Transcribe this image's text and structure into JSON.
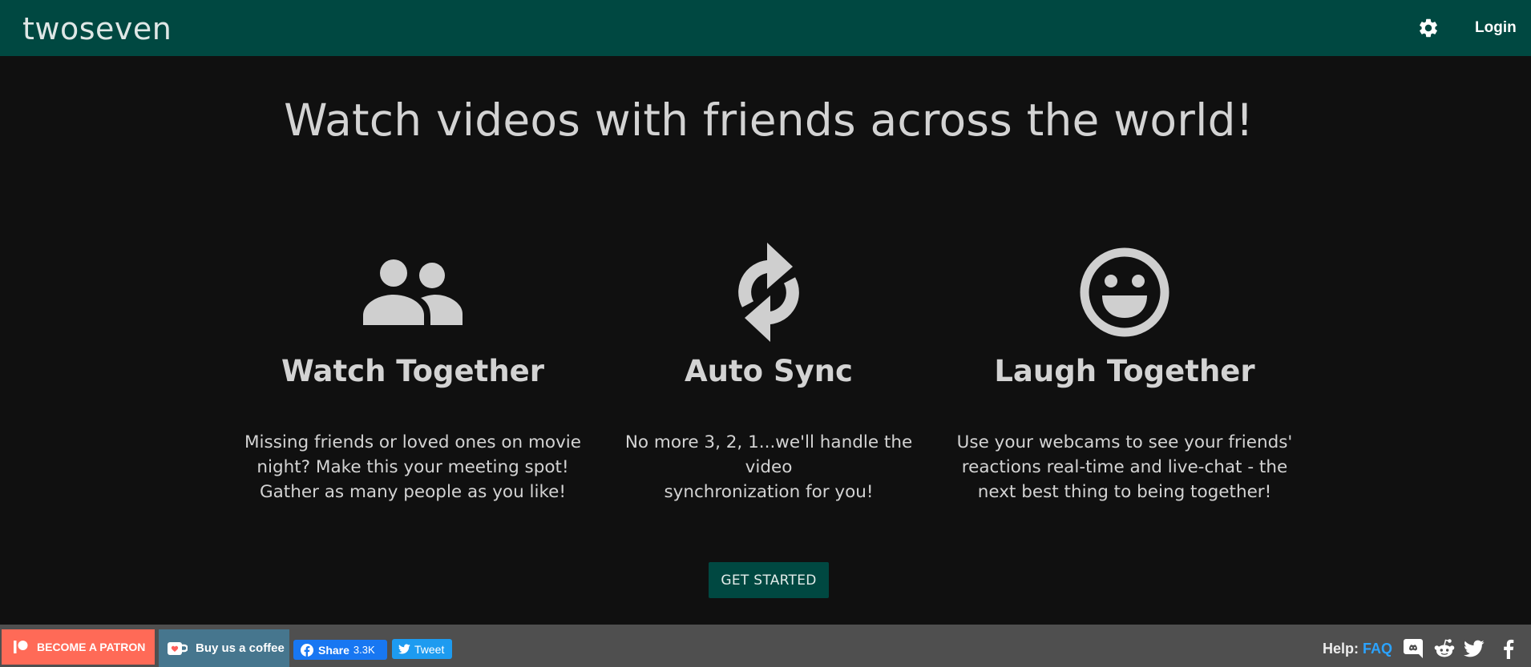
{
  "header": {
    "brand": "twoseven",
    "settings_icon": "gear-icon",
    "login_label": "Login"
  },
  "hero": {
    "title": "Watch videos with friends across the world!"
  },
  "features": [
    {
      "icon": "people-icon",
      "title": "Watch Together",
      "line1": "Missing friends or loved ones on movie",
      "line2": "night? Make this your meeting spot!",
      "line3": "Gather as many people as you like!"
    },
    {
      "icon": "sync-icon",
      "title": "Auto Sync",
      "line1": "No more 3, 2, 1...we'll handle the video",
      "line2": "synchronization for you!",
      "line3": ""
    },
    {
      "icon": "smiley-icon",
      "title": "Laugh Together",
      "line1": "Use your webcams to see your friends'",
      "line2": "reactions real-time and live-chat - the",
      "line3": "next best thing to being together!"
    }
  ],
  "cta": {
    "label": "GET STARTED"
  },
  "footer": {
    "patron_label": "BECOME A PATRON",
    "coffee_label": "Buy us a coffee",
    "fb_share_label": "Share",
    "fb_share_count": "3.3K",
    "tweet_label": "Tweet",
    "help_label": "Help:",
    "faq_label": "FAQ"
  },
  "colors": {
    "header_bg": "#004841",
    "page_bg": "#101010",
    "footer_bg": "#4f4f4f",
    "patron_bg": "#ff6a57",
    "coffee_bg": "#46768e",
    "facebook_bg": "#1877f2",
    "twitter_bg": "#1d9bf0",
    "link_blue": "#2ba3ff"
  }
}
